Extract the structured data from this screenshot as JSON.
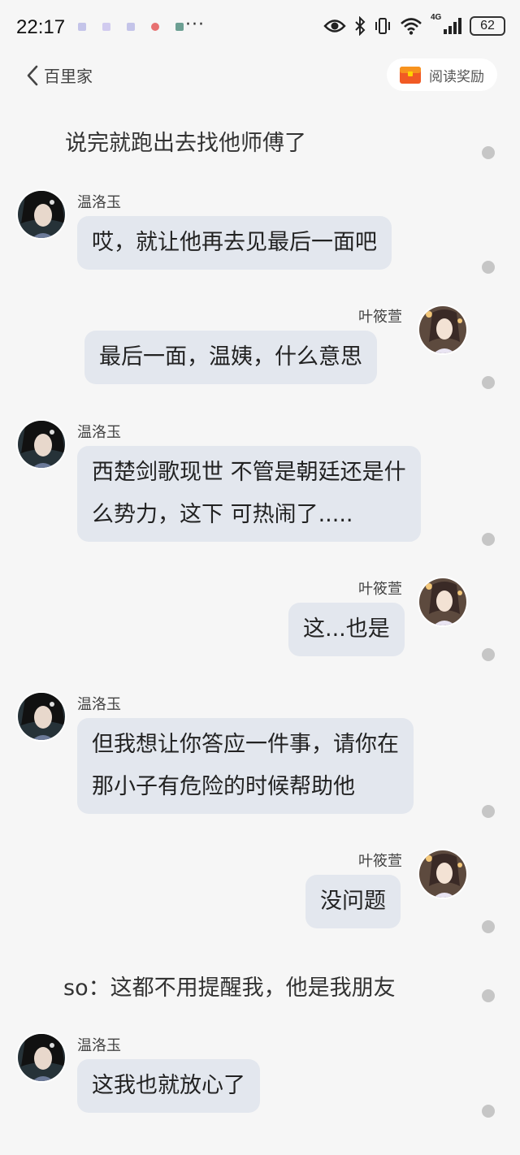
{
  "status_bar": {
    "time": "22:17",
    "more": "···",
    "network": "4G",
    "battery": "62",
    "notif_colors": [
      "#b8b8e6",
      "#c8c0ee",
      "#b8b8e6",
      "#e45050",
      "#4a8a7a"
    ]
  },
  "header": {
    "back_title": "百里家",
    "reward_label": "阅读奖励"
  },
  "characters": {
    "wen": {
      "name": "温洛玉"
    },
    "ye": {
      "name": "叶筱萱"
    }
  },
  "messages": [
    {
      "kind": "narration",
      "text": "说完就跑出去找他师傅了"
    },
    {
      "kind": "left",
      "speaker": "温洛玉",
      "lines": [
        "哎，就让他再去见最后一面吧"
      ]
    },
    {
      "kind": "right",
      "speaker": "叶筱萱",
      "lines": [
        "最后一面，温姨，什么意思"
      ]
    },
    {
      "kind": "left",
      "speaker": "温洛玉",
      "lines": [
        "西楚剑歌现世 不管是朝廷还是什",
        "么势力，这下 可热闹了....."
      ]
    },
    {
      "kind": "right",
      "speaker": "叶筱萱",
      "lines": [
        "这...也是"
      ]
    },
    {
      "kind": "left",
      "speaker": "温洛玉",
      "lines": [
        "但我想让你答应一件事，请你在",
        "那小子有危险的时候帮助他"
      ]
    },
    {
      "kind": "right",
      "speaker": "叶筱萱",
      "lines": [
        "没问题"
      ]
    },
    {
      "kind": "narration",
      "text": "so：这都不用提醒我，他是我朋友"
    },
    {
      "kind": "left",
      "speaker": "温洛玉",
      "lines": [
        "这我也就放心了"
      ]
    }
  ]
}
